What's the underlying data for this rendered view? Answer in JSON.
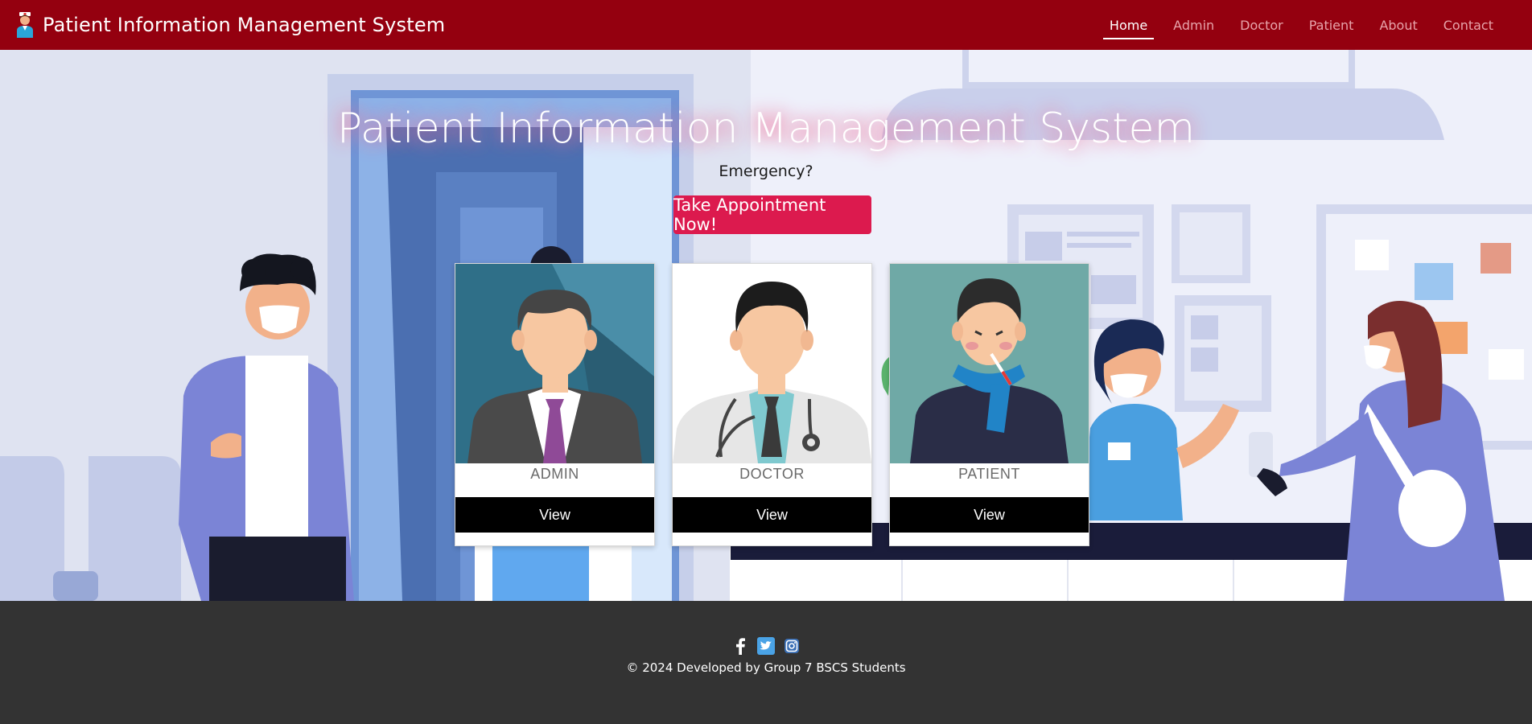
{
  "navbar": {
    "brand_title": "Patient Information Management System",
    "brand_icon": "nurse-icon",
    "links": [
      {
        "label": "Home",
        "active": true
      },
      {
        "label": "Admin",
        "active": false
      },
      {
        "label": "Doctor",
        "active": false
      },
      {
        "label": "Patient",
        "active": false
      },
      {
        "label": "About",
        "active": false
      },
      {
        "label": "Contact",
        "active": false
      }
    ],
    "background_color": "#94000f"
  },
  "hero": {
    "title": "Patient Information Management System",
    "subtitle": "Emergency?",
    "cta_label": "Take Appointment Now!",
    "cta_color": "#dc1a4e"
  },
  "cards": [
    {
      "label": "ADMIN",
      "button_label": "View",
      "image_icon": "admin-avatar-icon"
    },
    {
      "label": "DOCTOR",
      "button_label": "View",
      "image_icon": "doctor-avatar-icon"
    },
    {
      "label": "PATIENT",
      "button_label": "View",
      "image_icon": "patient-avatar-icon"
    }
  ],
  "footer": {
    "social_icons": [
      "facebook-icon",
      "twitter-icon",
      "instagram-icon"
    ],
    "copyright": "© 2024 Developed by Group 7 BSCS Students"
  }
}
